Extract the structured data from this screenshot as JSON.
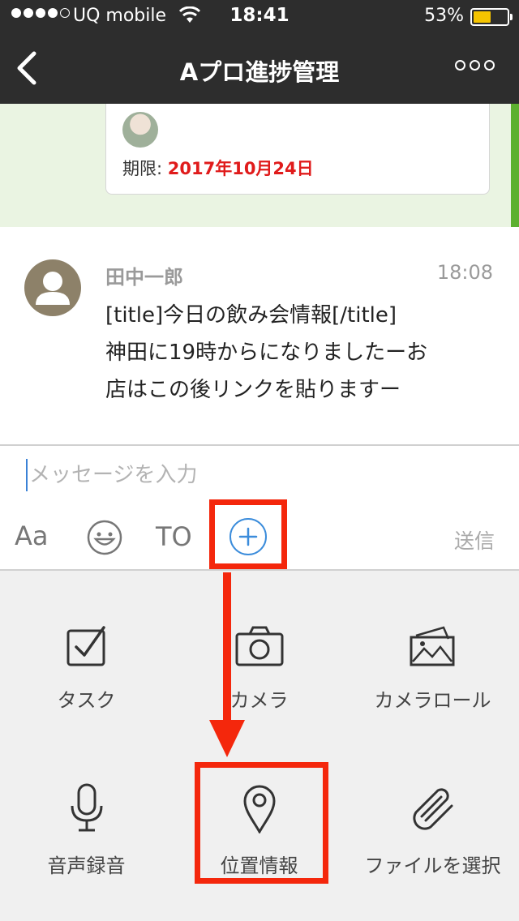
{
  "status_bar": {
    "carrier": "UQ mobile",
    "time": "18:41",
    "battery_percent": "53%",
    "battery_level": 0.53,
    "signal_bars": 4
  },
  "nav": {
    "title": "Aプロ進捗管理",
    "back_icon": "chevron-left-icon",
    "more_icon": "more-dots-icon"
  },
  "task_card": {
    "deadline_label": "期限: ",
    "deadline_date": "2017年10月24日"
  },
  "message": {
    "sender": "田中一郎",
    "time": "18:08",
    "line1": "[title]今日の飲み会情報[/title]",
    "line2": "神田に19時からになりましたーお",
    "line3": "店はこの後リンクを貼りますー"
  },
  "input": {
    "placeholder": "メッセージを入力"
  },
  "toolbar": {
    "aa_label": "Aa",
    "to_label": "TO",
    "send_label": "送信"
  },
  "attach_menu": {
    "task": "タスク",
    "camera": "カメラ",
    "camera_roll": "カメラロール",
    "voice": "音声録音",
    "location": "位置情報",
    "file": "ファイルを選択"
  },
  "colors": {
    "nav_bg": "#2d2d2d",
    "highlight": "#f4270c",
    "accent_green": "#5db02f",
    "deadline_red": "#e01b1b",
    "plus_blue": "#3b8cdb"
  }
}
